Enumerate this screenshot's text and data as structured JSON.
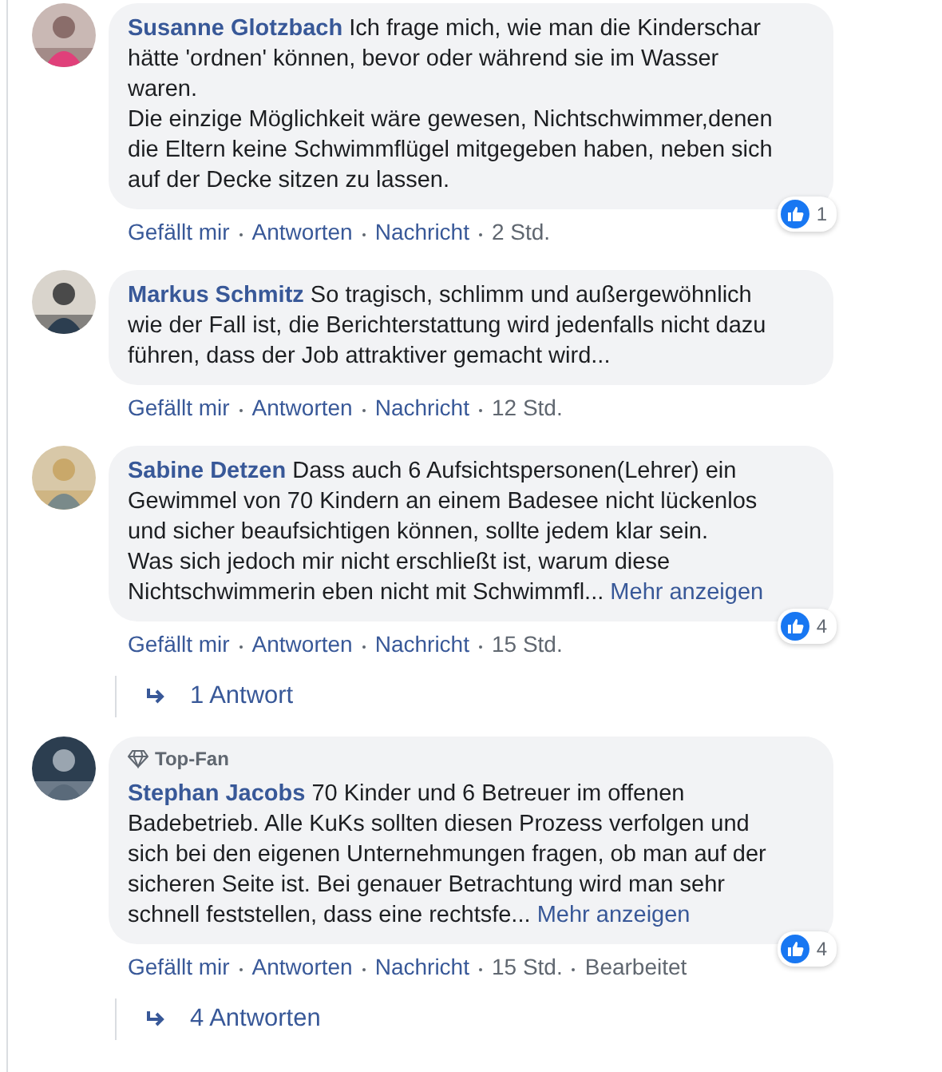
{
  "comments": [
    {
      "author": "Susanne Glotzbach",
      "text": " Ich frage mich, wie man die Kinderschar\nhätte 'ordnen' können, bevor oder während sie im Wasser\nwaren.\nDie einzige Möglichkeit wäre gewesen, Nichtschwimmer,denen\ndie Eltern keine Schwimmflügel mitgegeben haben, neben sich\nauf der Decke sitzen zu lassen.",
      "likes": "1",
      "actions": [
        "Gefällt mir",
        "Antworten",
        "Nachricht"
      ],
      "time": "2 Std."
    },
    {
      "author": "Markus Schmitz",
      "text": " So tragisch, schlimm und außergewöhnlich\nwie der Fall ist, die Berichterstattung wird jedenfalls nicht dazu\nführen, dass der Job attraktiver gemacht wird...",
      "actions": [
        "Gefällt mir",
        "Antworten",
        "Nachricht"
      ],
      "time": "12 Std."
    },
    {
      "author": "Sabine Detzen",
      "text": " Dass auch 6 Aufsichtspersonen(Lehrer) ein\nGewimmel von 70 Kindern an einem Badesee nicht lückenlos\nund sicher beaufsichtigen können, sollte jedem klar sein.\nWas sich jedoch mir nicht erschließt ist, warum diese\nNichtschwimmerin eben nicht mit Schwimmfl... ",
      "more": "Mehr anzeigen",
      "likes": "4",
      "actions": [
        "Gefällt mir",
        "Antworten",
        "Nachricht"
      ],
      "time": "15 Std.",
      "replies": "1 Antwort"
    },
    {
      "badge": "Top-Fan",
      "author": "Stephan Jacobs",
      "text": " 70 Kinder und 6 Betreuer im offenen\nBadebetrieb. Alle KuKs sollten diesen Prozess verfolgen und\nsich bei den eigenen Unternehmungen fragen, ob man auf der\nsicheren Seite ist. Bei genauer Betrachtung wird man sehr\nschnell feststellen, dass eine rechtsfe... ",
      "more": "Mehr anzeigen",
      "likes": "4",
      "actions": [
        "Gefällt mir",
        "Antworten",
        "Nachricht"
      ],
      "time": "15 Std.",
      "edited": "Bearbeitet",
      "replies": "4 Antworten"
    }
  ]
}
